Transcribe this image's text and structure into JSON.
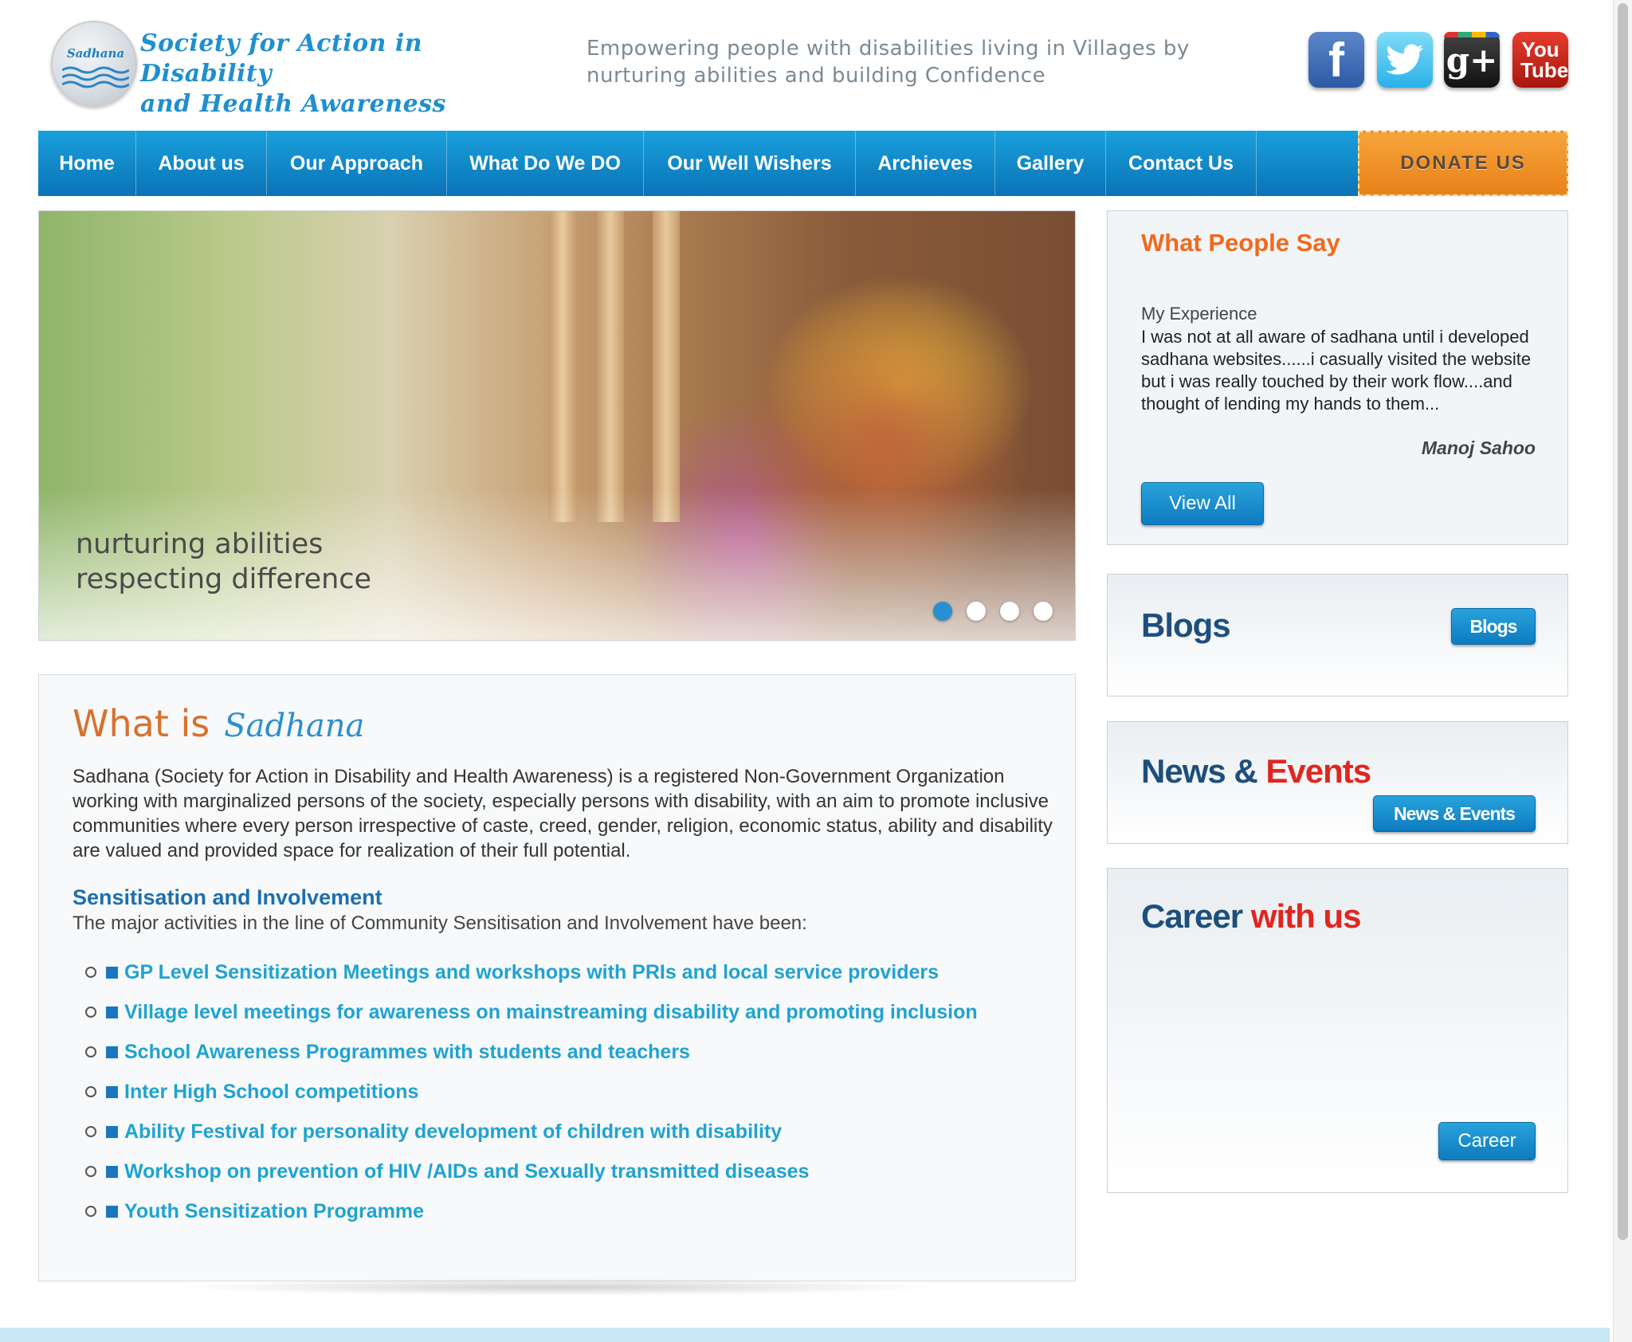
{
  "logo": {
    "mark": "Sadhana",
    "line1": "Society for Action in Disability",
    "line2": "and Health Awareness"
  },
  "tagline": {
    "line1": "Empowering people with disabilities living in Villages by",
    "line2": "nurturing abilities and building Confidence"
  },
  "social": [
    {
      "name": "facebook-icon",
      "glyph": "f"
    },
    {
      "name": "twitter-icon",
      "glyph": ""
    },
    {
      "name": "google-plus-icon",
      "glyph": "g+"
    },
    {
      "name": "youtube-icon",
      "glyph": "You Tube"
    }
  ],
  "nav": {
    "items": [
      "Home",
      "About us",
      "Our Approach",
      "What Do We DO",
      "Our Well Wishers",
      "Archieves",
      "Gallery",
      "Contact Us"
    ],
    "donate": "DONATE US"
  },
  "slider": {
    "caption_line1": "nurturing abilities",
    "caption_line2": "respecting difference",
    "slide_count": 4,
    "active_slide": 1
  },
  "about": {
    "title": "What is",
    "brand": "Sadhana",
    "text": "Sadhana (Society for Action in Disability and Health Awareness) is a registered Non-Government Organization working with marginalized persons of the society, especially persons with disability, with an aim to promote inclusive communities where every person irrespective of caste, creed, gender, religion, economic status, ability and disability are valued and provided space for realization of their full potential.",
    "sub_title": "Sensitisation and Involvement",
    "sub_text": "The major activities in the line of Community Sensitisation and Involvement have been:",
    "activities": [
      "GP Level Sensitization Meetings and workshops with PRIs and local service providers",
      "Village level meetings for awareness on mainstreaming disability and promoting inclusion",
      "School Awareness Programmes with students and teachers",
      "Inter High School competitions",
      "Ability Festival for personality development of children with disability",
      "Workshop on prevention of HIV /AIDs and Sexually transmitted diseases",
      "Youth Sensitization Programme"
    ]
  },
  "testimonial": {
    "title": "What People Say",
    "heading": "My Experience",
    "body": "I was not at all aware of sadhana until i developed sadhana websites......i casually visited the website but i was really touched by their work flow....and thought of lending my hands to them...",
    "author": "Manoj Sahoo",
    "button": "View All"
  },
  "blogs": {
    "title": "Blogs",
    "button": "Blogs"
  },
  "news": {
    "title_part1": "News &",
    "title_part2": "Events",
    "button": "News & Events"
  },
  "career": {
    "title_part1": "Career",
    "title_part2": "with us",
    "button": "Career"
  },
  "colors": {
    "nav_blue": "#0a73b6",
    "donate_orange": "#e8821a",
    "accent_orange": "#f06a1d",
    "link_blue": "#1ea3d2",
    "title_navy": "#1d4f7c",
    "title_red": "#e0261f"
  }
}
